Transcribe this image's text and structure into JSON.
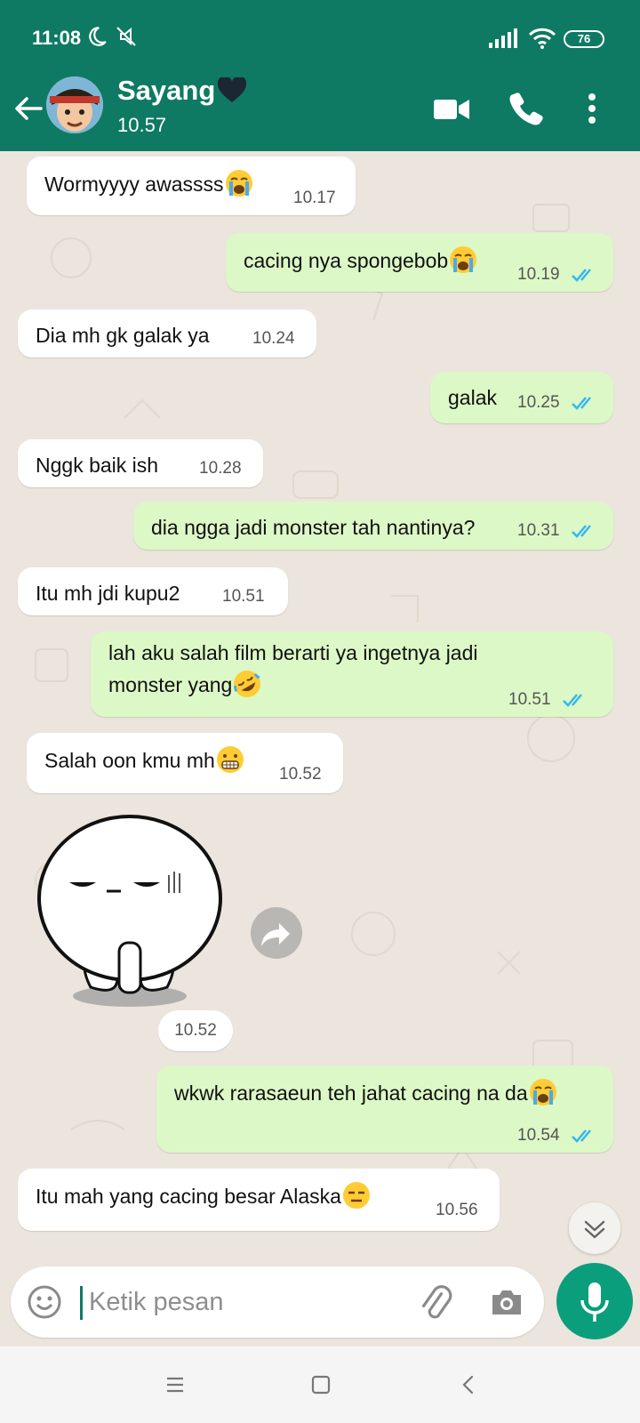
{
  "status_bar": {
    "time": "11:08",
    "battery": "76",
    "icons": [
      "moon-icon",
      "mute-icon",
      "signal-icon",
      "wifi-icon",
      "battery-icon"
    ]
  },
  "header": {
    "contact_name": "Sayang",
    "subtitle": "10.57",
    "buttons": [
      "back-arrow-icon",
      "video-call-icon",
      "phone-icon",
      "more-vert-icon"
    ]
  },
  "messages": [
    {
      "dir": "in",
      "text": "Wormyyyy awassss",
      "emoji": "crying",
      "time": "10.17"
    },
    {
      "dir": "out",
      "text": "cacing nya spongebob",
      "emoji": "crying",
      "time": "10.19",
      "ticks": "read"
    },
    {
      "dir": "in",
      "text": "Dia mh gk galak ya",
      "time": "10.24"
    },
    {
      "dir": "out",
      "text": "galak",
      "time": "10.25",
      "ticks": "read"
    },
    {
      "dir": "in",
      "text": "Nggk baik ish",
      "time": "10.28"
    },
    {
      "dir": "out",
      "text": "dia ngga jadi monster tah nantinya?",
      "time": "10.31",
      "ticks": "read"
    },
    {
      "dir": "in",
      "text": "Itu mh jdi kupu2",
      "time": "10.51"
    },
    {
      "dir": "out",
      "text_line1": "lah aku salah film berarti ya ingetnya jadi",
      "text_line2": "monster yang",
      "emoji": "rofl",
      "time": "10.51",
      "ticks": "read"
    },
    {
      "dir": "in",
      "text": "Salah oon kmu mh",
      "emoji": "grimacing",
      "time": "10.52"
    },
    {
      "dir": "in",
      "type": "sticker",
      "time": "10.52"
    },
    {
      "dir": "out",
      "text": "wkwk rarasaeun teh jahat cacing na da",
      "emoji": "crying",
      "time": "10.54",
      "ticks": "read"
    },
    {
      "dir": "in",
      "text": "Itu mah yang cacing besar Alaska",
      "emoji": "expressionless",
      "time": "10.56"
    }
  ],
  "input": {
    "placeholder": "Ketik pesan"
  },
  "colors": {
    "header": "#0e7a63",
    "chat_bg": "#ece5dd",
    "outgoing_bubble": "#dcf8c6",
    "incoming_bubble": "#ffffff",
    "read_ticks": "#34b7f1",
    "mic_button": "#0b9e7c"
  },
  "nav_bar": [
    "menu-icon",
    "home-icon",
    "back-icon"
  ]
}
